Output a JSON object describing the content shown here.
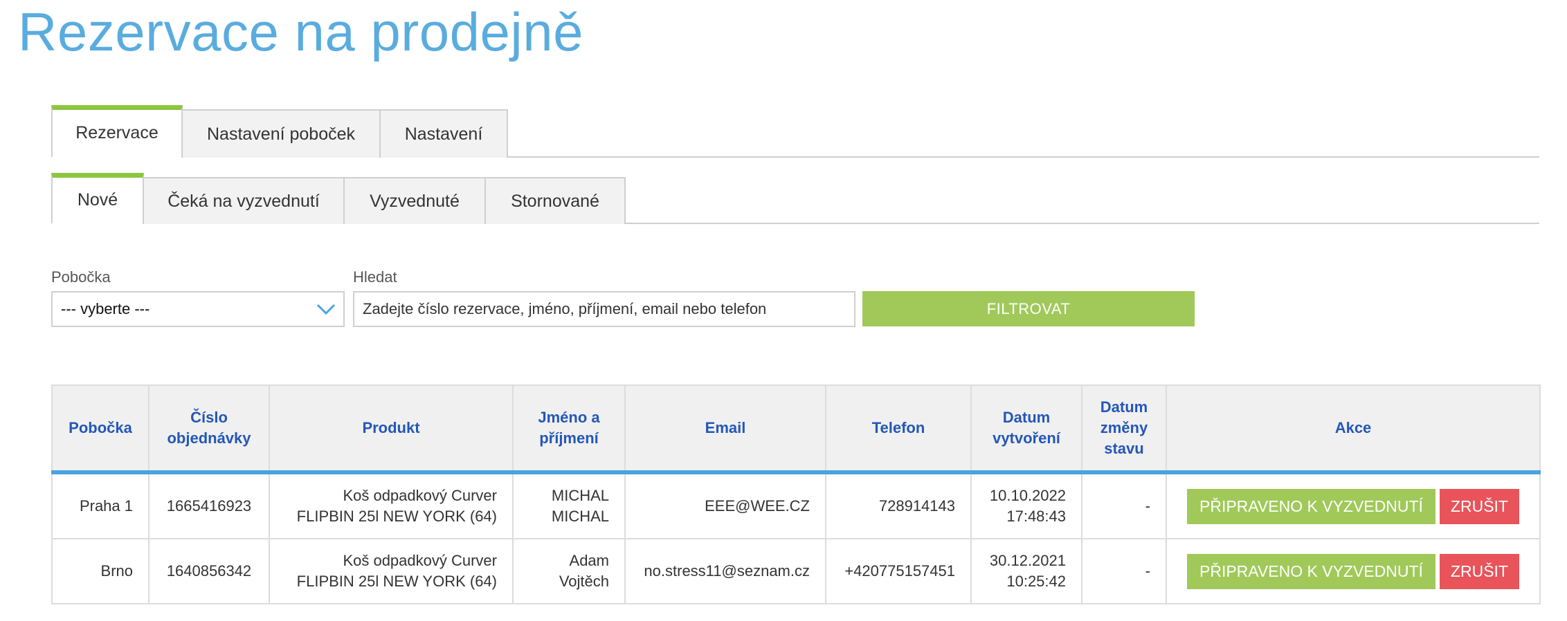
{
  "page": {
    "title": "Rezervace na prodejně"
  },
  "main_tabs": [
    {
      "label": "Rezervace",
      "active": true
    },
    {
      "label": "Nastavení poboček",
      "active": false
    },
    {
      "label": "Nastavení",
      "active": false
    }
  ],
  "sub_tabs": [
    {
      "label": "Nové",
      "active": true
    },
    {
      "label": "Čeká na vyzvednutí",
      "active": false
    },
    {
      "label": "Vyzvednuté",
      "active": false
    },
    {
      "label": "Stornované",
      "active": false
    }
  ],
  "filters": {
    "branch_label": "Pobočka",
    "branch_value": "--- vyberte ---",
    "search_label": "Hledat",
    "search_placeholder": "Zadejte číslo rezervace, jméno, příjmení, email nebo telefon",
    "filter_button": "FILTROVAT"
  },
  "table": {
    "headers": [
      "Pobočka",
      "Číslo objednávky",
      "Produkt",
      "Jméno a příjmení",
      "Email",
      "Telefon",
      "Datum vytvoření",
      "Datum změny stavu",
      "Akce"
    ],
    "rows": [
      {
        "branch": "Praha 1",
        "order": "1665416923",
        "product_1": "Koš odpadkový Curver",
        "product_2": "FLIPBIN 25l NEW YORK (64)",
        "name_1": "MICHAL",
        "name_2": "MICHAL",
        "email": "EEE@WEE.CZ",
        "phone": "728914143",
        "created_date": "10.10.2022",
        "created_time": "17:48:43",
        "changed": "-",
        "ready_label": "PŘIPRAVENO K VYZVEDNUTÍ",
        "cancel_label": "ZRUŠIT"
      },
      {
        "branch": "Brno",
        "order": "1640856342",
        "product_1": "Koš odpadkový Curver",
        "product_2": "FLIPBIN 25l NEW YORK (64)",
        "name_1": "Adam",
        "name_2": "Vojtěch",
        "email": "no.stress11@seznam.cz",
        "phone": "+420775157451",
        "created_date": "30.12.2021",
        "created_time": "10:25:42",
        "changed": "-",
        "ready_label": "PŘIPRAVENO K VYZVEDNUTÍ",
        "cancel_label": "ZRUŠIT"
      }
    ]
  },
  "colors": {
    "title": "#5aacde",
    "accent_green": "#a0c95a",
    "tab_active": "#8dc63f",
    "header_text": "#2457b6",
    "header_underline": "#4aa3df",
    "cancel_red": "#e8545a"
  },
  "icons": {
    "select_arrow": "chevron-down-icon"
  }
}
